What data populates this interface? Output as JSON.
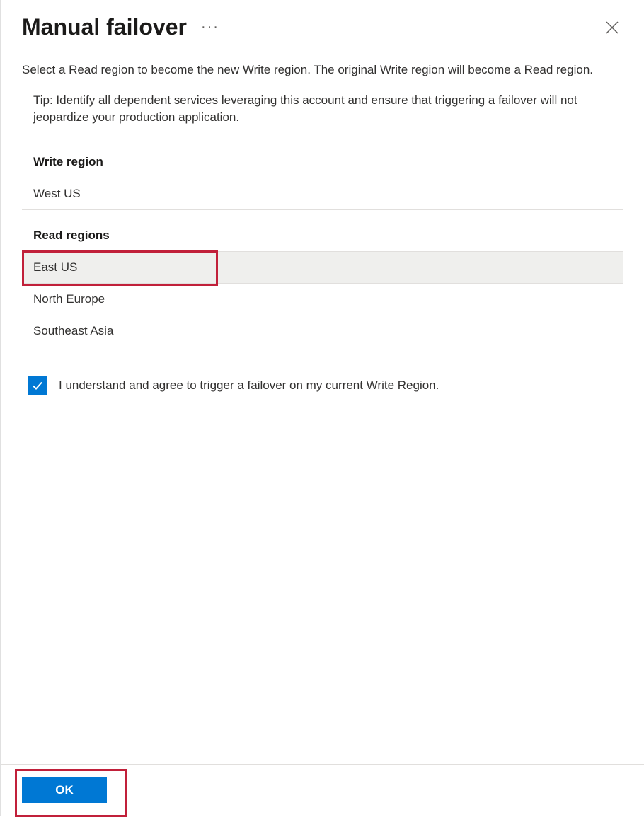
{
  "header": {
    "title": "Manual failover"
  },
  "intro": "Select a Read region to become the new Write region. The original Write region will become a Read region.",
  "tip": "Tip: Identify all dependent services leveraging this account and ensure that triggering a failover will not jeopardize your production application.",
  "writeRegion": {
    "heading": "Write region",
    "value": "West US"
  },
  "readRegions": {
    "heading": "Read regions",
    "items": [
      "East US",
      "North Europe",
      "Southeast Asia"
    ],
    "selectedIndex": 0
  },
  "consent": {
    "checked": true,
    "label": "I understand and agree to trigger a failover on my current Write Region."
  },
  "footer": {
    "okLabel": "OK"
  }
}
